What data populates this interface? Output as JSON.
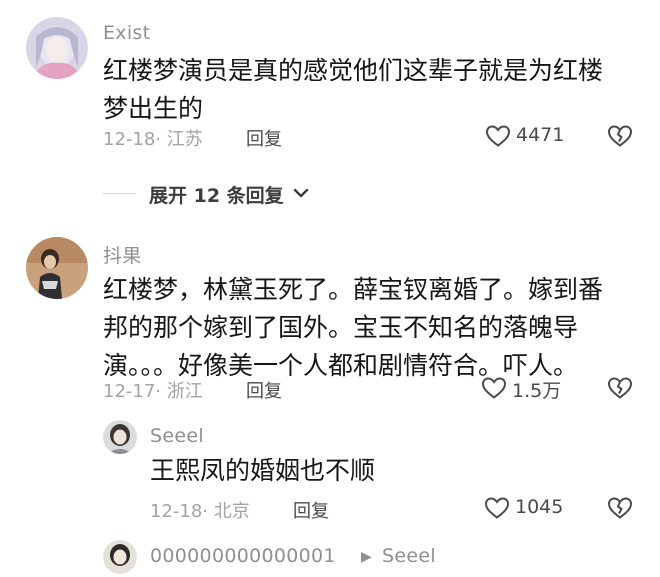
{
  "comments": [
    {
      "username": "Exist",
      "text_lines": [
        "红楼梦演员是真的感觉他们这辈子就是为红楼",
        "梦出生的"
      ],
      "meta": "12-18· 江苏",
      "reply_label": "回复",
      "likes": "4471"
    },
    {
      "username": "抖果",
      "text_lines": [
        "红楼梦，林黛玉死了。薛宝钗离婚了。嫁到番",
        "邦的那个嫁到了国外。宝玉不知名的落魄导",
        "演。。。好像美一个人都和剧情符合。吓人。"
      ],
      "meta": "12-17· 浙江",
      "reply_label": "回复",
      "likes": "1.5万"
    }
  ],
  "expand_replies": {
    "label": "展开 12 条回复"
  },
  "sub_replies": [
    {
      "username": "Seeel",
      "text": "王熙凤的婚姻也不顺",
      "meta": "12-18· 北京",
      "reply_label": "回复",
      "likes": "1045"
    },
    {
      "username": "000000000000001",
      "reply_to": "Seeel"
    }
  ],
  "icons": {
    "like": "heart-outline-icon",
    "dislike": "broken-heart-icon",
    "expand": "chevron-down-icon",
    "reply_to": "triangle-right-icon"
  }
}
